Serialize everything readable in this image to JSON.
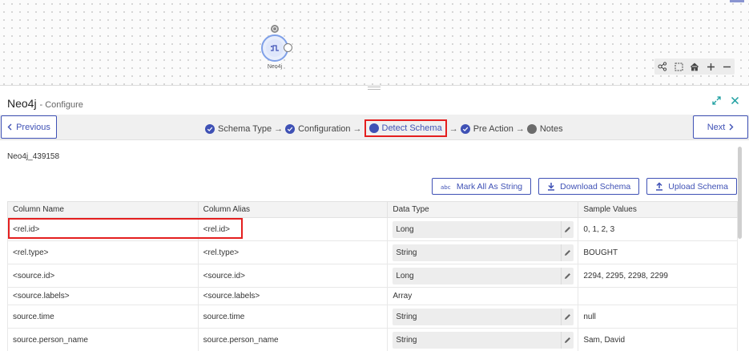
{
  "canvas": {
    "node_label": "Neo4j",
    "tools": [
      "share-nodes-icon",
      "select-box-icon",
      "home-icon",
      "zoom-in-icon",
      "zoom-out-icon"
    ]
  },
  "panel": {
    "title": "Neo4j",
    "subtitle": "- Configure",
    "icons": [
      "expand-icon",
      "close-icon"
    ]
  },
  "wizard": {
    "prev_label": "Previous",
    "next_label": "Next",
    "steps": [
      {
        "label": "Schema Type",
        "status": "done"
      },
      {
        "label": "Configuration",
        "status": "done"
      },
      {
        "label": "Detect Schema",
        "status": "active"
      },
      {
        "label": "Pre Action",
        "status": "done"
      },
      {
        "label": "Notes",
        "status": "pending"
      }
    ],
    "arrow": "→"
  },
  "record_name": "Neo4j_439158",
  "actions": {
    "mark_string": "Mark All As String",
    "download": "Download Schema",
    "upload": "Upload Schema"
  },
  "table": {
    "headers": [
      "Column Name",
      "Column Alias",
      "Data Type",
      "Sample Values"
    ],
    "rows": [
      {
        "name": "<rel.id>",
        "alias": "<rel.id>",
        "type": "Long",
        "editable": true,
        "sample": "0, 1, 2, 3"
      },
      {
        "name": "<rel.type>",
        "alias": "<rel.type>",
        "type": "String",
        "editable": true,
        "sample": "BOUGHT"
      },
      {
        "name": "<source.id>",
        "alias": "<source.id>",
        "type": "Long",
        "editable": true,
        "sample": "2294, 2295, 2298, 2299"
      },
      {
        "name": "<source.labels>",
        "alias": "<source.labels>",
        "type": "Array",
        "editable": false,
        "sample": ""
      },
      {
        "name": "source.time",
        "alias": "source.time",
        "type": "String",
        "editable": true,
        "sample": "null"
      },
      {
        "name": "source.person_name",
        "alias": "source.person_name",
        "type": "String",
        "editable": true,
        "sample": "Sam, David"
      }
    ]
  },
  "colors": {
    "accent": "#3f51b5",
    "highlight": "#e41f1f"
  }
}
